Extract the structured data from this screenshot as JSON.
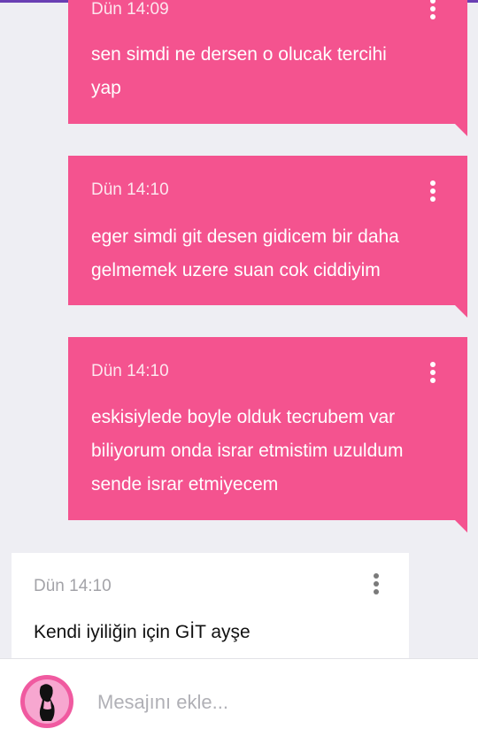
{
  "messages": [
    {
      "type": "sent",
      "timestamp": "Dün 14:09",
      "lines": [
        "sen simdi ne dersen o olucak tercihi",
        "yap"
      ]
    },
    {
      "type": "sent",
      "timestamp": "Dün 14:10",
      "lines": [
        "eger simdi git desen gidicem bir daha",
        "gelmemek uzere suan cok ciddiyim"
      ]
    },
    {
      "type": "sent",
      "timestamp": "Dün 14:10",
      "lines": [
        "eskisiylede boyle olduk tecrubem var",
        "biliyorum onda israr etmistim uzuldum",
        "sende israr etmiyecem"
      ]
    },
    {
      "type": "received",
      "timestamp": "Dün 14:10",
      "lines": [
        "Kendi iyiliğin için GİT ayşe"
      ]
    }
  ],
  "composer": {
    "placeholder": "Mesajını ekle...",
    "avatar_icon": "user-avatar"
  },
  "colors": {
    "sent_bubble": "#f4538f",
    "received_bubble": "#ffffff",
    "background": "#eeeef3",
    "top_bar": "#6a3fb3"
  }
}
